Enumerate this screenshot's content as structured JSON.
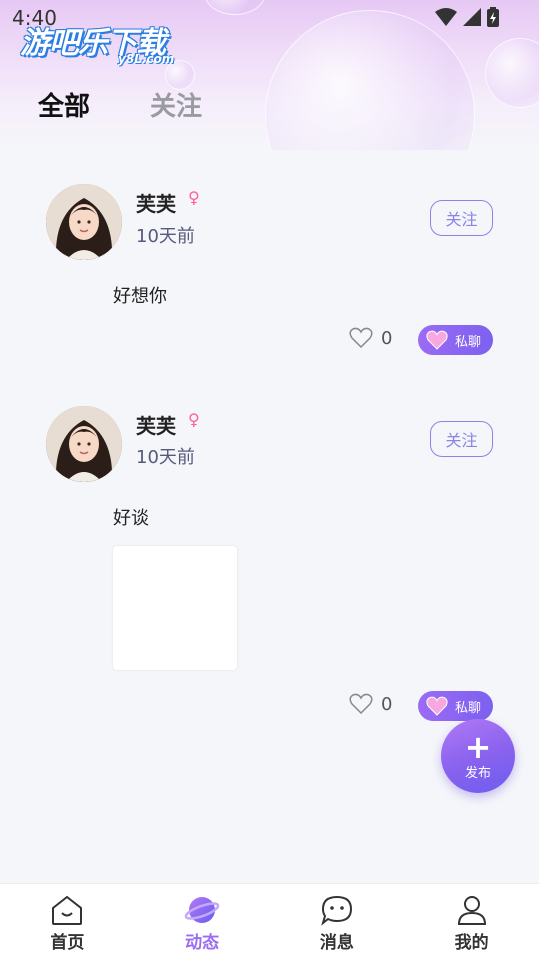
{
  "status_bar": {
    "time": "4:40"
  },
  "logo": {
    "main": "游吧乐下载",
    "sub": "y8L.com"
  },
  "tabs": [
    {
      "label": "全部",
      "active": true
    },
    {
      "label": "关注",
      "active": false
    }
  ],
  "posts": [
    {
      "username": "芙芙",
      "gender_symbol": "♀",
      "time": "10天前",
      "follow_label": "关注",
      "content": "好想你",
      "likes": "0",
      "chat_label": "私聊",
      "has_image": false
    },
    {
      "username": "芙芙",
      "gender_symbol": "♀",
      "time": "10天前",
      "follow_label": "关注",
      "content": "好谈",
      "likes": "0",
      "chat_label": "私聊",
      "has_image": true
    }
  ],
  "fab": {
    "plus": "+",
    "label": "发布"
  },
  "bottom_nav": [
    {
      "label": "首页",
      "icon": "home-icon",
      "active": false
    },
    {
      "label": "动态",
      "icon": "planet-icon",
      "active": true
    },
    {
      "label": "消息",
      "icon": "message-icon",
      "active": false
    },
    {
      "label": "我的",
      "icon": "profile-icon",
      "active": false
    }
  ],
  "colors": {
    "accent": "#8a84e6",
    "chat_gradient_start": "#9b6bf5",
    "female": "#ff5fa0"
  }
}
